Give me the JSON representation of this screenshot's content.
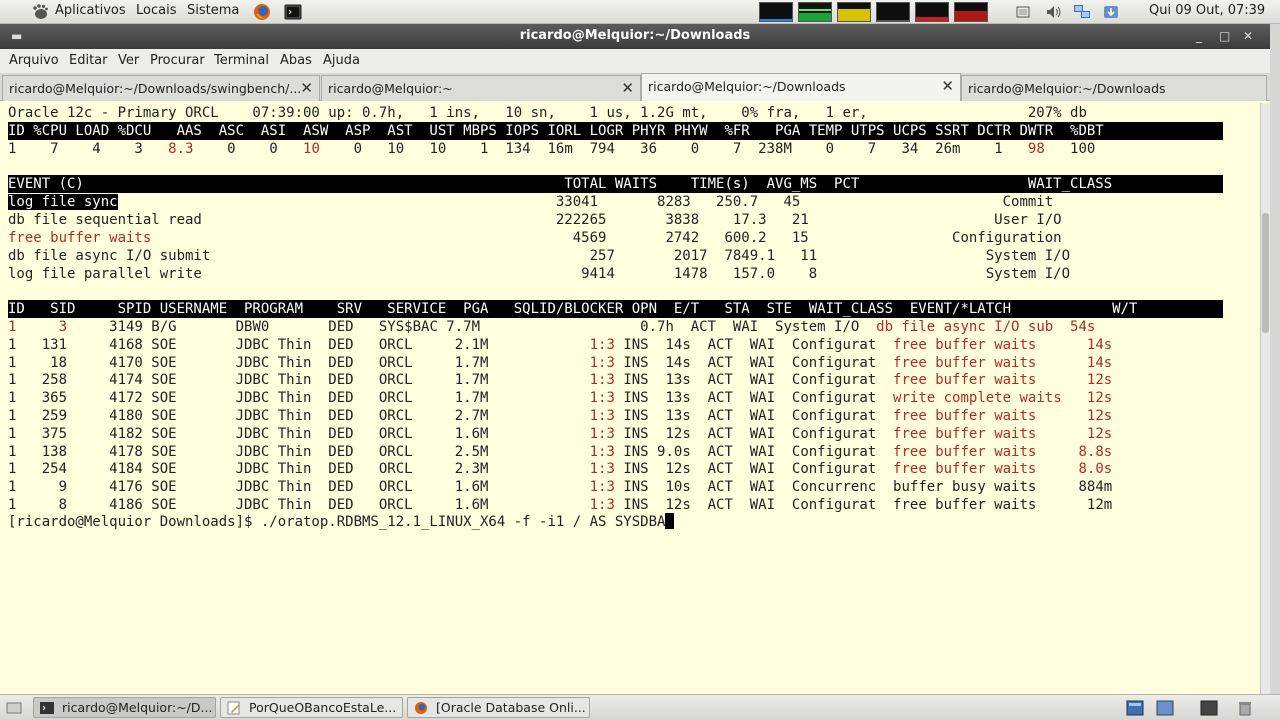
{
  "top_panel": {
    "menus": [
      "Aplicativos",
      "Locais",
      "Sistema"
    ],
    "clock": "Qui 09 Out, 07:39"
  },
  "window": {
    "title": "ricardo@Melquior:~/Downloads",
    "menu": [
      "Arquivo",
      "Editar",
      "Ver",
      "Procurar",
      "Terminal",
      "Abas",
      "Ajuda"
    ],
    "tabs": [
      {
        "label": "ricardo@Melquior:~/Downloads/swingbench/...",
        "active": false
      },
      {
        "label": "ricardo@Melquior:~",
        "active": false
      },
      {
        "label": "ricardo@Melquior:~/Downloads",
        "active": true
      },
      {
        "label": "ricardo@Melquior:~/Downloads",
        "active": false
      }
    ]
  },
  "terminal": {
    "status_line": "Oracle 12c - Primary ORCL    07:39:00 up: 0.7h,   1 ins,   10 sn,    1 us, 1.2G mt,    0% fra,   1 er,                   207% db",
    "stats_header": "ID %CPU LOAD %DCU   AAS  ASC  ASI  ASW  ASP  AST  UST MBPS IOPS IORL LOGR PHYR PHYW  %FR   PGA TEMP UTPS UCPS SSRT DCTR DWTR  %DBT",
    "stats_row": [
      {
        "t": "1    7    4    3   ",
        "red": false
      },
      {
        "t": "8.3",
        "red": true
      },
      {
        "t": "    0    0   ",
        "red": false
      },
      {
        "t": "10",
        "red": true
      },
      {
        "t": "    0   10   10    1  134  16m  794   36    0    7  238M    0    7   34  26m    1   ",
        "red": false
      },
      {
        "t": "98",
        "red": true
      },
      {
        "t": "   100",
        "red": false
      }
    ],
    "events_header": "EVENT (C)                                                         TOTAL WAITS    TIME(s)  AVG_MS  PCT                    WAIT_CLASS",
    "events": [
      {
        "name": "log file sync",
        "rest": "                                                    33041       8283   250.7   45                        Commit",
        "name_style": "sel"
      },
      {
        "name": "db file sequential read",
        "rest": "                                          222265       3838    17.3   21                      User I/O",
        "name_style": ""
      },
      {
        "name": "free buffer waits",
        "rest": "                                                  4569       2742   600.2   15                 Configuration",
        "name_style": "red"
      },
      {
        "name": "db file async I/O submit",
        "rest": "                                             257       2017  7849.1   11                    System I/O",
        "name_style": ""
      },
      {
        "name": "log file parallel write",
        "rest": "                                             9414       1478   157.0    8                    System I/O",
        "name_style": ""
      }
    ],
    "sessions_header": "ID   SID     SPID USERNAME  PROGRAM    SRV   SERVICE  PGA   SQLID/BLOCKER OPN  E/T   STA  STE  WAIT_CLASS  EVENT/*LATCH            W/T",
    "sessions": [
      [
        {
          "t": "1     3",
          "red": true
        },
        {
          "t": "     3149 B/G       DBW0       DED   SYS$BAC 7.7M                   0.7h  ACT  WAI  System I/O  ",
          "red": false
        },
        {
          "t": "db file async I/O sub  54s",
          "red": true
        }
      ],
      [
        {
          "t": "1   131     4168 SOE       JDBC Thin  DED   ORCL     2.1M            ",
          "red": false
        },
        {
          "t": "1:3",
          "red": true
        },
        {
          "t": " INS  14s  ACT  WAI  Configurat  ",
          "red": false
        },
        {
          "t": "free buffer waits      14s",
          "red": true
        }
      ],
      [
        {
          "t": "1    18     4170 SOE       JDBC Thin  DED   ORCL     1.7M            ",
          "red": false
        },
        {
          "t": "1:3",
          "red": true
        },
        {
          "t": " INS  14s  ACT  WAI  Configurat  ",
          "red": false
        },
        {
          "t": "free buffer waits      14s",
          "red": true
        }
      ],
      [
        {
          "t": "1   258     4174 SOE       JDBC Thin  DED   ORCL     1.7M            ",
          "red": false
        },
        {
          "t": "1:3",
          "red": true
        },
        {
          "t": " INS  13s  ACT  WAI  Configurat  ",
          "red": false
        },
        {
          "t": "free buffer waits      12s",
          "red": true
        }
      ],
      [
        {
          "t": "1   365     4172 SOE       JDBC Thin  DED   ORCL     1.7M            ",
          "red": false
        },
        {
          "t": "1:3",
          "red": true
        },
        {
          "t": " INS  13s  ACT  WAI  Configurat  ",
          "red": false
        },
        {
          "t": "write complete waits   12s",
          "red": true
        }
      ],
      [
        {
          "t": "1   259     4180 SOE       JDBC Thin  DED   ORCL     2.7M            ",
          "red": false
        },
        {
          "t": "1:3",
          "red": true
        },
        {
          "t": " INS  13s  ACT  WAI  Configurat  ",
          "red": false
        },
        {
          "t": "free buffer waits      12s",
          "red": true
        }
      ],
      [
        {
          "t": "1   375     4182 SOE       JDBC Thin  DED   ORCL     1.6M            ",
          "red": false
        },
        {
          "t": "1:3",
          "red": true
        },
        {
          "t": " INS  12s  ACT  WAI  Configurat  ",
          "red": false
        },
        {
          "t": "free buffer waits      12s",
          "red": true
        }
      ],
      [
        {
          "t": "1   138     4178 SOE       JDBC Thin  DED   ORCL     2.5M            ",
          "red": false
        },
        {
          "t": "1:3",
          "red": true
        },
        {
          "t": " INS 9.0s  ACT  WAI  Configurat  ",
          "red": false
        },
        {
          "t": "free buffer waits     8.8s",
          "red": true
        }
      ],
      [
        {
          "t": "1   254     4184 SOE       JDBC Thin  DED   ORCL     2.3M            ",
          "red": false
        },
        {
          "t": "1:3",
          "red": true
        },
        {
          "t": " INS  12s  ACT  WAI  Configurat  ",
          "red": false
        },
        {
          "t": "free buffer waits     8.0s",
          "red": true
        }
      ],
      [
        {
          "t": "1     9     4176 SOE       JDBC Thin  DED   ORCL     1.6M            ",
          "red": false
        },
        {
          "t": "1:3",
          "red": true
        },
        {
          "t": " INS  10s  ACT  WAI  Concurrenc  buffer busy waits     884m",
          "red": false
        }
      ],
      [
        {
          "t": "1     8     4186 SOE       JDBC Thin  DED   ORCL     1.6M            ",
          "red": false
        },
        {
          "t": "1:3",
          "red": true
        },
        {
          "t": " INS  12s  ACT  WAI  Configurat  free buffer waits      12m",
          "red": false
        }
      ]
    ],
    "prompt": "[ricardo@Melquior Downloads]$ ./oratop.RDBMS_12.1_LINUX_X64 -f -i1 / AS SYSDBA"
  },
  "taskbar": [
    {
      "label": "ricardo@Melquior:~/D...",
      "icon": "terminal-icon",
      "active": true
    },
    {
      "label": "PorQueOBancoEstaLe...",
      "icon": "text-editor-icon",
      "active": false
    },
    {
      "label": "[Oracle Database Onli...",
      "icon": "browser-icon",
      "active": false
    }
  ],
  "colors": {
    "terminal_bg": "#ffffdd",
    "alert_red": "#b22a2a",
    "header_bg": "#000000"
  }
}
